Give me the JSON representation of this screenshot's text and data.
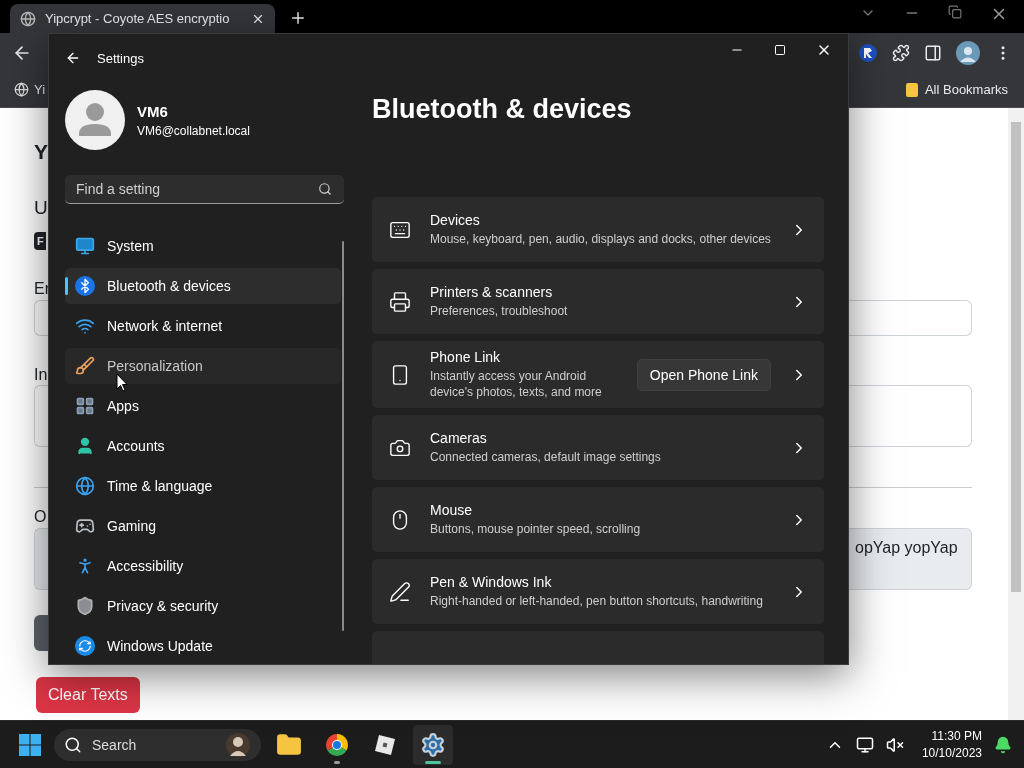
{
  "browser": {
    "tab": {
      "title": "Yipcrypt - Coyote AES encryptio",
      "selected": true
    },
    "bookmarks": [
      {
        "label": "Yi"
      },
      {
        "label": "All Bookmarks"
      }
    ],
    "page": {
      "heading": "Y",
      "subheading": "U",
      "badge": "F",
      "labels": [
        "Er",
        "In",
        "O"
      ],
      "output_text": "opYap yopYap",
      "clear_button": "Clear Texts"
    }
  },
  "settings": {
    "title": "Settings",
    "user": {
      "name": "VM6",
      "email": "VM6@collabnet.local"
    },
    "search": {
      "placeholder": "Find a setting"
    },
    "nav": [
      {
        "label": "System",
        "selected": false,
        "hovered": false
      },
      {
        "label": "Bluetooth & devices",
        "selected": true,
        "hovered": false
      },
      {
        "label": "Network & internet",
        "selected": false,
        "hovered": false
      },
      {
        "label": "Personalization",
        "selected": false,
        "hovered": true
      },
      {
        "label": "Apps",
        "selected": false,
        "hovered": false
      },
      {
        "label": "Accounts",
        "selected": false,
        "hovered": false
      },
      {
        "label": "Time & language",
        "selected": false,
        "hovered": false
      },
      {
        "label": "Gaming",
        "selected": false,
        "hovered": false
      },
      {
        "label": "Accessibility",
        "selected": false,
        "hovered": false
      },
      {
        "label": "Privacy & security",
        "selected": false,
        "hovered": false
      },
      {
        "label": "Windows Update",
        "selected": false,
        "hovered": false
      }
    ],
    "heading": "Bluetooth & devices",
    "cards": [
      {
        "title": "Devices",
        "description": "Mouse, keyboard, pen, audio, displays and docks, other devices"
      },
      {
        "title": "Printers & scanners",
        "description": "Preferences, troubleshoot"
      },
      {
        "title": "Phone Link",
        "description": "Instantly access your Android device's photos, texts, and more",
        "button": "Open Phone Link"
      },
      {
        "title": "Cameras",
        "description": "Connected cameras, default image settings"
      },
      {
        "title": "Mouse",
        "description": "Buttons, mouse pointer speed, scrolling"
      },
      {
        "title": "Pen & Windows Ink",
        "description": "Right-handed or left-handed, pen button shortcuts, handwriting"
      }
    ]
  },
  "taskbar": {
    "search": {
      "placeholder": "Search"
    },
    "apps": [
      {
        "running": false,
        "active": false
      },
      {
        "running": true,
        "active": false
      },
      {
        "running": false,
        "active": false
      },
      {
        "running": true,
        "active": true
      }
    ],
    "time": "11:30 PM",
    "date": "10/10/2023"
  }
}
